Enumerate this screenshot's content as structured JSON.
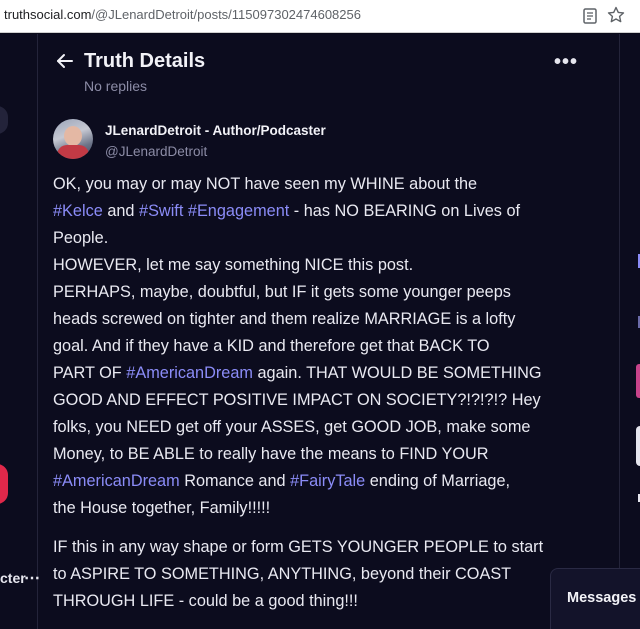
{
  "browser": {
    "url_host": "truthsocial.com",
    "url_path": "/@JLenardDetroit/posts/115097302474608256"
  },
  "header": {
    "title": "Truth Details",
    "subtitle": "No replies"
  },
  "author": {
    "name": "JLenardDetroit - Author/Podcaster",
    "handle": "@JLenardDetroit"
  },
  "post": {
    "lines": [
      [
        {
          "t": "OK, you may or may NOT have seen my WHINE about the"
        }
      ],
      [
        {
          "t": "#Kelce",
          "tag": true
        },
        {
          "t": " and "
        },
        {
          "t": "#Swift",
          "tag": true
        },
        {
          "t": " "
        },
        {
          "t": "#Engagement",
          "tag": true
        },
        {
          "t": " - has NO BEARING on Lives of"
        }
      ],
      [
        {
          "t": "People."
        }
      ],
      [
        {
          "t": "HOWEVER, let me say something NICE this post."
        }
      ],
      [
        {
          "t": "PERHAPS, maybe, doubtful, but IF it gets some younger peeps"
        }
      ],
      [
        {
          "t": "heads screwed on tighter and them realize MARRIAGE is a lofty"
        }
      ],
      [
        {
          "t": "goal. And if they have a KID and therefore get that BACK TO"
        }
      ],
      [
        {
          "t": "PART OF "
        },
        {
          "t": "#AmericanDream",
          "tag": true
        },
        {
          "t": " again. THAT WOULD BE SOMETHING"
        }
      ],
      [
        {
          "t": "GOOD AND EFFECT POSITIVE IMPACT ON SOCIETY?!?!?!? Hey"
        }
      ],
      [
        {
          "t": "folks, you NEED get off your ASSES, get GOOD JOB, make some"
        }
      ],
      [
        {
          "t": "Money, to BE ABLE to really have the means to FIND YOUR"
        }
      ],
      [
        {
          "t": "#AmericanDream",
          "tag": true
        },
        {
          "t": " Romance and "
        },
        {
          "t": "#FairyTale",
          "tag": true
        },
        {
          "t": " ending of Marriage,"
        }
      ],
      [
        {
          "t": "the House together, Family!!!!!"
        }
      ],
      "gap",
      [
        {
          "t": "IF this in any way shape or form GETS YOUNGER PEOPLE to start"
        }
      ],
      [
        {
          "t": "to ASPIRE TO SOMETHING, ANYTHING, beyond their COAST"
        }
      ],
      [
        {
          "t": "THROUGH LIFE - could be a good thing!!!"
        }
      ]
    ]
  },
  "messages": {
    "label": "Messages"
  },
  "left_nav": {
    "partial_label": "cter"
  },
  "colors": {
    "background": "#0c0c1e",
    "hashtag": "#8b8cf7",
    "text": "#e9e9f1",
    "muted": "#8c8ca6"
  },
  "icons": [
    "reader-view-icon",
    "bookmark-star-icon",
    "back-arrow-icon",
    "more-options-icon"
  ]
}
